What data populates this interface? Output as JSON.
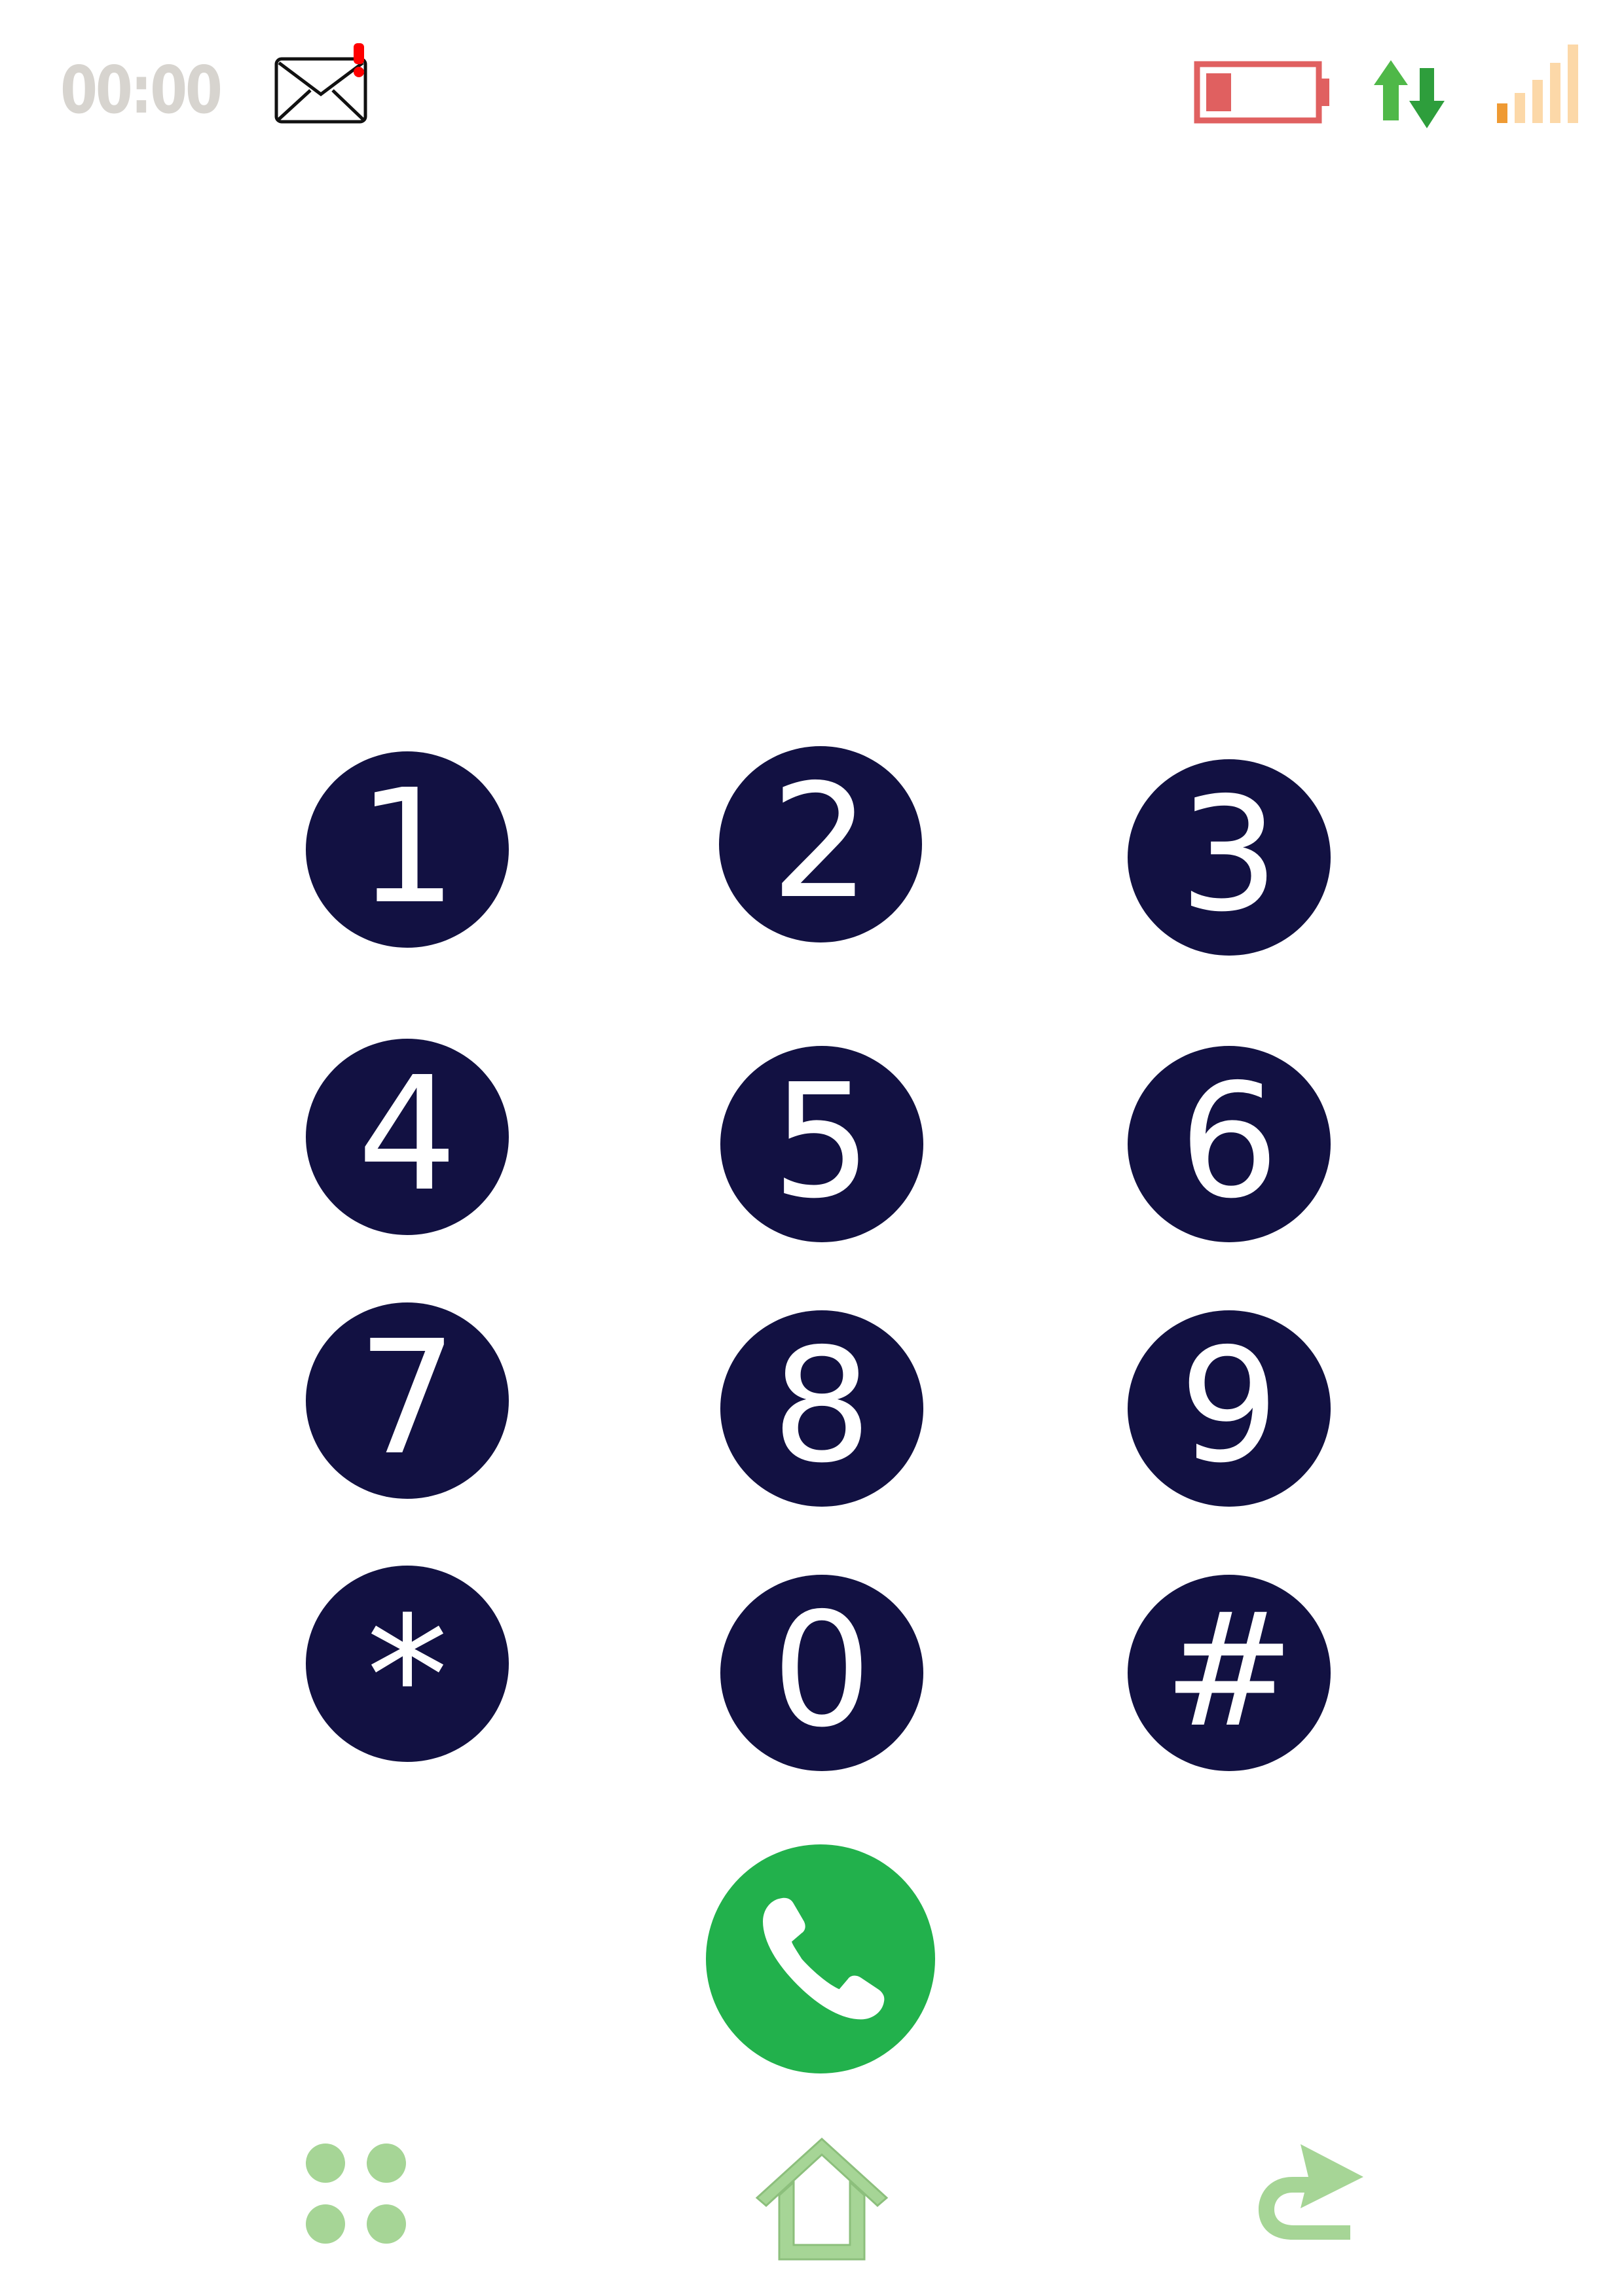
{
  "status_bar": {
    "time": "00:00",
    "icons": [
      "mail-notification-icon",
      "battery-low-icon",
      "data-transfer-icon",
      "signal-strength-icon"
    ],
    "battery_level": 0.15,
    "signal_bars_active": 1,
    "signal_bars_total": 5,
    "colors": {
      "clock": "#d7d4cf",
      "notification_dot": "#ff0000",
      "battery": "#e06060",
      "data_up": "#4fb848",
      "data_down": "#2e9e3c",
      "signal_active": "#ef9a33",
      "signal_inactive": "#fcd8a8"
    }
  },
  "keypad": {
    "keys": [
      "1",
      "2",
      "3",
      "4",
      "5",
      "6",
      "7",
      "8",
      "9",
      "*",
      "0",
      "#"
    ],
    "key_color": "#121142",
    "digit_color": "#ffffff"
  },
  "call": {
    "icon": "phone-handset-icon",
    "color": "#22b14c"
  },
  "navigation": {
    "icons": [
      "apps-grid-icon",
      "home-icon",
      "back-arrow-icon"
    ],
    "color": "#a6d596"
  }
}
